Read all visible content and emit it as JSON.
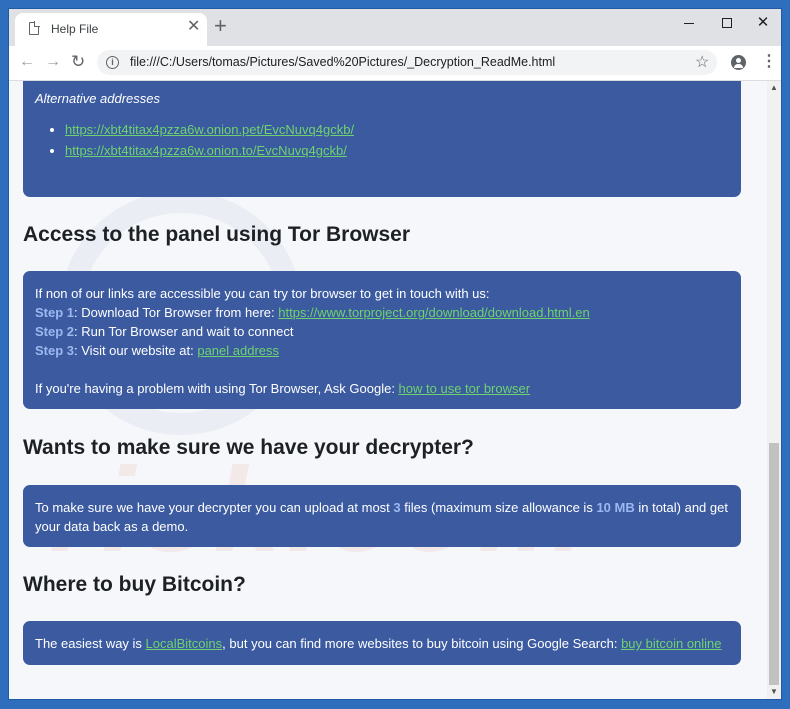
{
  "tab": {
    "title": "Help File",
    "close": "✕",
    "new_tab": "+"
  },
  "window_controls": {
    "minimize": "minimize",
    "maximize": "maximize",
    "close": "✕"
  },
  "toolbar": {
    "back": "←",
    "forward": "→",
    "reload": "↻",
    "url": "file:///C:/Users/tomas/Pictures/Saved%20Pictures/_Decryption_ReadMe.html",
    "bookmark": "☆",
    "menu": "⋮"
  },
  "page": {
    "alt_heading": "Alternative addresses",
    "alt_links": [
      "https://xbt4titax4pzza6w.onion.pet/EvcNuvq4gckb/",
      "https://xbt4titax4pzza6w.onion.to/EvcNuvq4gckb/"
    ],
    "tor": {
      "heading": "Access to the panel using Tor Browser",
      "intro": "If non of our links are accessible you can try tor browser to get in touch with us:",
      "step1_label": "Step 1",
      "step1_text": ": Download Tor Browser from here: ",
      "step1_link": "https://www.torproject.org/download/download.html.en",
      "step2_label": "Step 2",
      "step2_text": ": Run Tor Browser and wait to connect",
      "step3_label": "Step 3",
      "step3_text": ": Visit our website at: ",
      "step3_link": "panel address",
      "problem_text": "If you're having a problem with using Tor Browser, Ask Google: ",
      "problem_link": "how to use tor browser"
    },
    "decrypter": {
      "heading": "Wants to make sure we have your decrypter?",
      "text1": "To make sure we have your decrypter you can upload at most ",
      "files_count": "3",
      "text2": " files (maximum size allowance is ",
      "size": "10 MB",
      "text3": " in total) and get your data back as a demo."
    },
    "bitcoin": {
      "heading": "Where to buy Bitcoin?",
      "text1": "The easiest way is ",
      "link1": "LocalBitcoins",
      "text2": ", but you can find more websites to buy bitcoin using Google Search: ",
      "link2": "buy bitcoin online"
    }
  },
  "colors": {
    "panel": "#3b5aa0",
    "link": "#6ed36e",
    "step": "#9db8f0",
    "desktop": "#2f6dbd"
  }
}
